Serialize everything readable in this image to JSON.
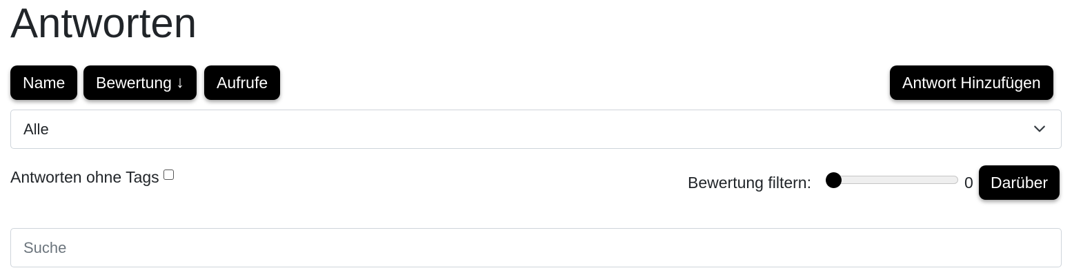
{
  "page": {
    "title": "Antworten"
  },
  "sort_buttons": {
    "name_label": "Name",
    "rating_label": "Bewertung",
    "rating_sort_arrow": "↓",
    "views_label": "Aufrufe"
  },
  "add_button": {
    "label": "Antwort Hinzufügen"
  },
  "tag_select": {
    "selected": "Alle"
  },
  "untagged_filter": {
    "label": "Antworten ohne Tags",
    "checked": false
  },
  "rating_filter": {
    "label": "Bewertung filtern:",
    "value": "0",
    "button_label": "Darüber"
  },
  "search": {
    "placeholder": "Suche",
    "value": ""
  },
  "colors": {
    "button_bg": "#000000",
    "button_text": "#ffffff",
    "border": "#ced4da",
    "placeholder": "#6c757d"
  }
}
